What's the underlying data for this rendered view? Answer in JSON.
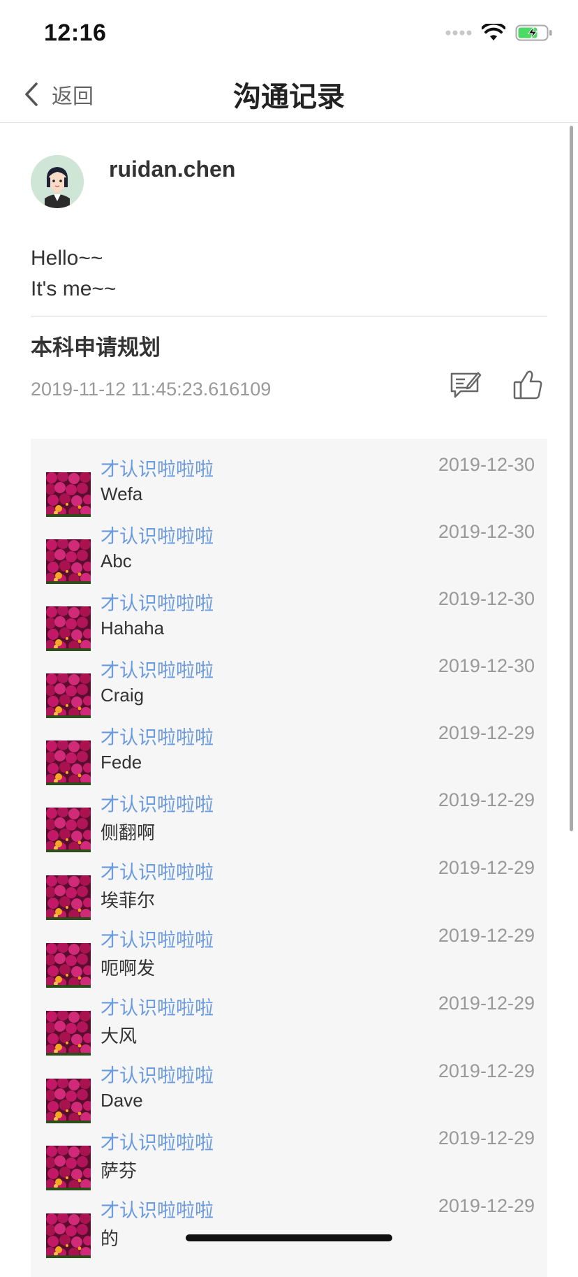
{
  "status_bar": {
    "time": "12:16"
  },
  "nav": {
    "back_label": "返回",
    "title": "沟通记录"
  },
  "post": {
    "author": "ruidan.chen",
    "body_lines": [
      "Hello~~",
      "It's me~~"
    ],
    "tag": "本科申请规划",
    "timestamp": "2019-11-12 11:45:23.616109"
  },
  "comments": [
    {
      "name": "才认识啦啦啦",
      "date": "2019-12-30",
      "text": "Wefa"
    },
    {
      "name": "才认识啦啦啦",
      "date": "2019-12-30",
      "text": "Abc"
    },
    {
      "name": "才认识啦啦啦",
      "date": "2019-12-30",
      "text": "Hahaha"
    },
    {
      "name": "才认识啦啦啦",
      "date": "2019-12-30",
      "text": "Craig"
    },
    {
      "name": "才认识啦啦啦",
      "date": "2019-12-29",
      "text": "Fede"
    },
    {
      "name": "才认识啦啦啦",
      "date": "2019-12-29",
      "text": "侧翻啊"
    },
    {
      "name": "才认识啦啦啦",
      "date": "2019-12-29",
      "text": "埃菲尔"
    },
    {
      "name": "才认识啦啦啦",
      "date": "2019-12-29",
      "text": "呃啊发"
    },
    {
      "name": "才认识啦啦啦",
      "date": "2019-12-29",
      "text": "大风"
    },
    {
      "name": "才认识啦啦啦",
      "date": "2019-12-29",
      "text": "Dave"
    },
    {
      "name": "才认识啦啦啦",
      "date": "2019-12-29",
      "text": "萨芬"
    },
    {
      "name": "才认识啦啦啦",
      "date": "2019-12-29",
      "text": "的"
    }
  ],
  "colors": {
    "link_name": "#6a9be0",
    "battery": "#4cd964",
    "flower": "#b0155a"
  },
  "icons": {
    "back": "chevron-left-icon",
    "comment": "comment-edit-icon",
    "like": "thumbs-up-icon",
    "wifi": "wifi-icon",
    "battery": "battery-charging-icon"
  }
}
